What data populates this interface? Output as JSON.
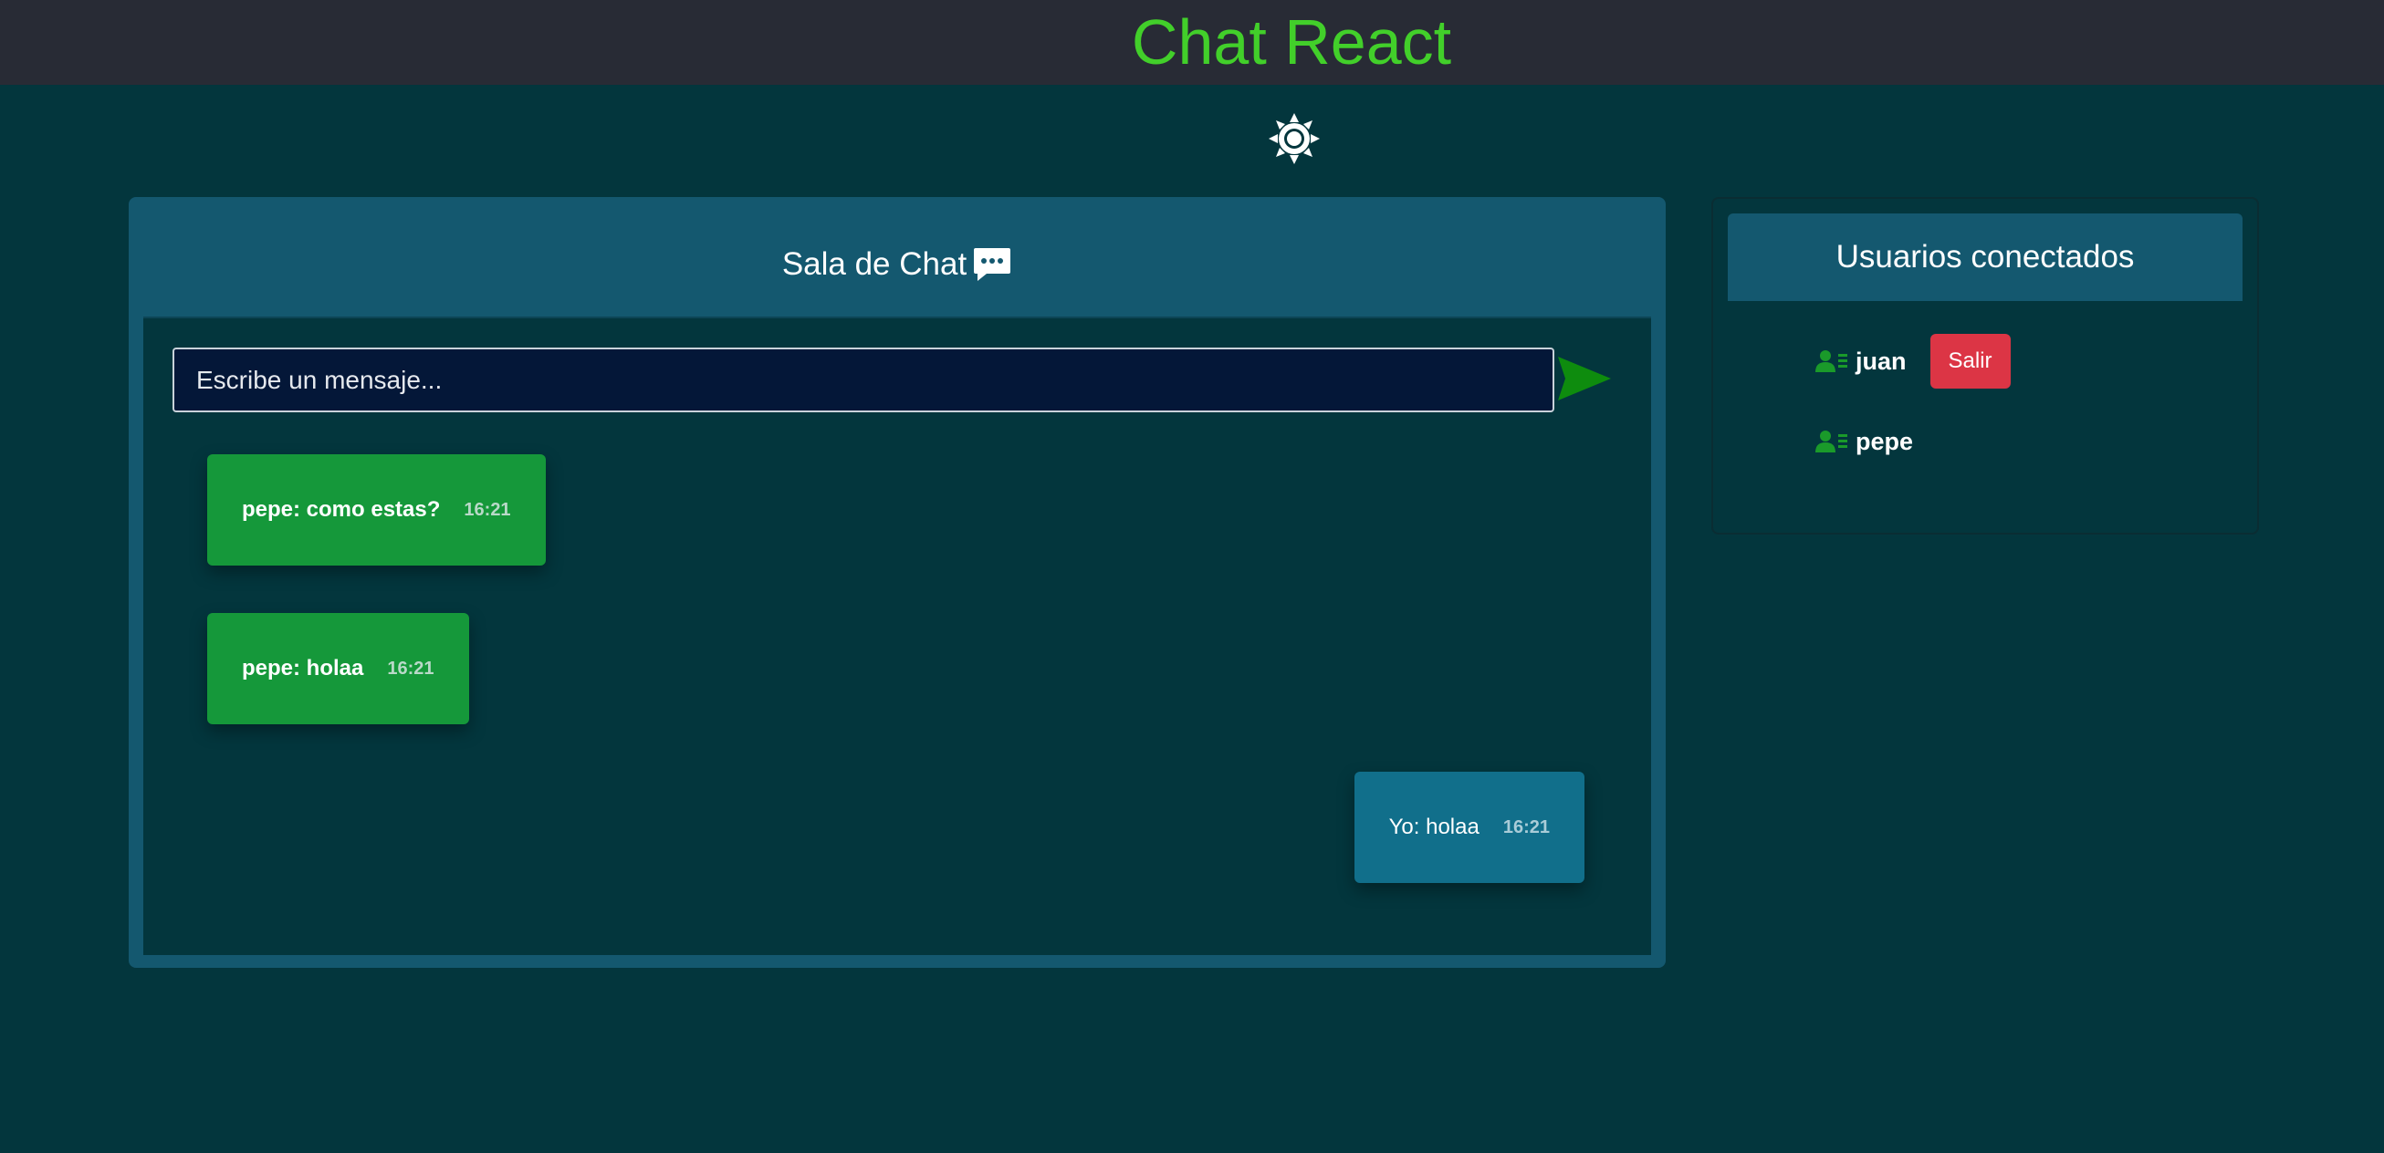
{
  "header": {
    "title": "Chat React",
    "title_color": "#42cf2a",
    "theme_toggle_icon": "sun-icon"
  },
  "chat": {
    "title": "Sala de Chat",
    "title_icon": "chat-dots-icon",
    "input": {
      "placeholder": "Escribe un mensaje...",
      "value": ""
    },
    "send_icon": "send-icon",
    "messages": [
      {
        "text": "pepe: como estas?",
        "time": "16:21",
        "sender": "other"
      },
      {
        "text": "pepe: holaa",
        "time": "16:21",
        "sender": "other"
      },
      {
        "text": "Yo: holaa",
        "time": "16:21",
        "sender": "me"
      }
    ]
  },
  "users": {
    "title": "Usuarios conectados",
    "list": [
      {
        "name": "juan",
        "logout_label": "Salir"
      },
      {
        "name": "pepe"
      }
    ]
  },
  "colors": {
    "background": "#03363d",
    "topbar": "#282b35",
    "panel_header": "#14586f",
    "bubble_other": "#15983a",
    "bubble_mine": "#116f8b",
    "logout_button": "#dc3545",
    "send_icon": "#0e8c0e"
  }
}
